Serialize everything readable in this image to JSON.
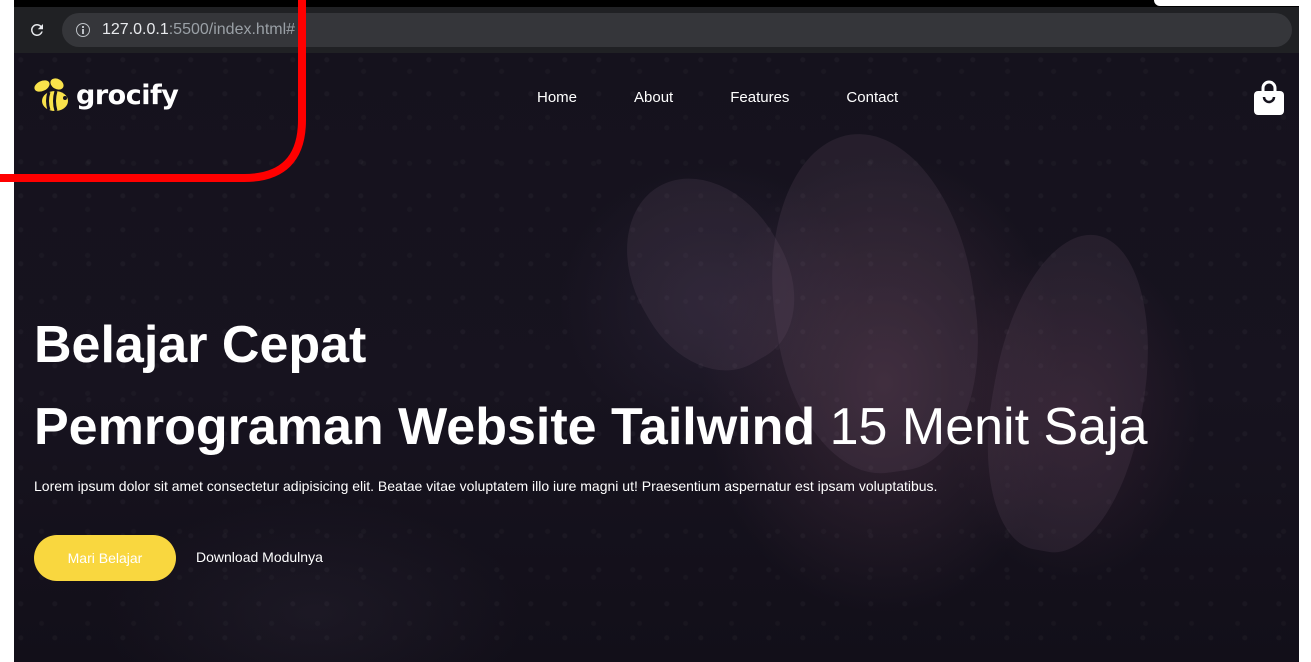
{
  "browser": {
    "url_host": "127.0.0.1",
    "url_rest": ":5500/index.html#"
  },
  "nav": {
    "logo_text": "grocify",
    "links": [
      "Home",
      "About",
      "Features",
      "Contact"
    ]
  },
  "hero": {
    "headline_line1": "Belajar Cepat",
    "headline_line2_bold": "Pemrograman Website Tailwind",
    "headline_line2_light": "15 Menit Saja",
    "description": "Lorem ipsum dolor sit amet consectetur adipisicing elit. Beatae vitae voluptatem illo iure magni ut! Praesentium aspernatur est ipsam voluptatibus.",
    "primary_button": "Mari Belajar",
    "secondary_button": "Download Modulnya"
  },
  "colors": {
    "accent_yellow": "#f9d73f",
    "annotation_red": "#ff0000",
    "hero_dark": "#15121d"
  },
  "icons": {
    "reload": "reload-icon",
    "site_info": "info-icon",
    "logo": "bee-logo-icon",
    "cart": "shopping-bag-icon"
  }
}
